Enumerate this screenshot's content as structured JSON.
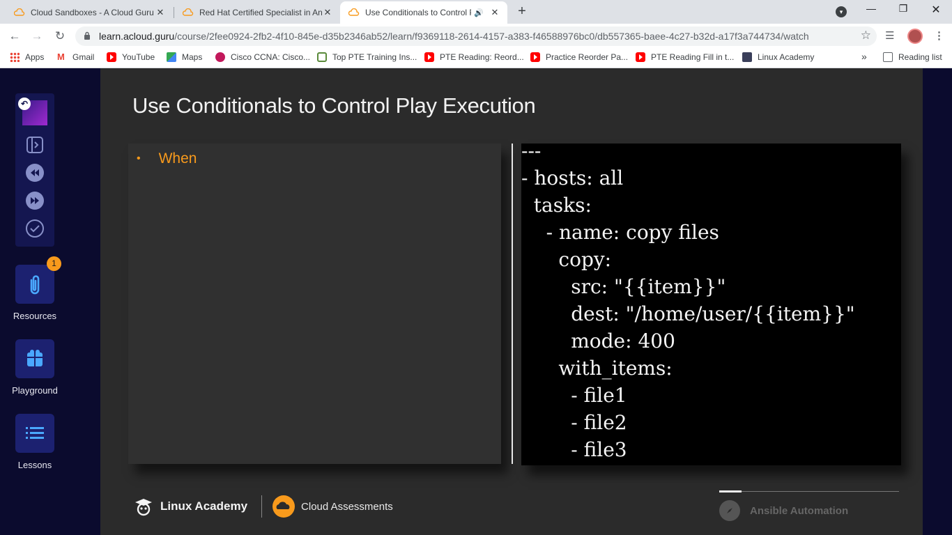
{
  "browser": {
    "tabs": [
      {
        "title": "Cloud Sandboxes - A Cloud Guru",
        "close": "✕"
      },
      {
        "title": "Red Hat Certified Specialist in An",
        "close": "✕"
      },
      {
        "title": "Use Conditionals to Control P",
        "close": "✕",
        "active": true
      }
    ],
    "new_tab": "+",
    "url_host": "learn.acloud.guru",
    "url_path": "/course/2fee0924-2fb2-4f10-845e-d35b2346ab52/learn/f9369118-2614-4157-a383-f46588976bc0/db557365-baee-4c27-b32d-a17f3a744734/watch",
    "bookmarks": [
      {
        "label": "Apps",
        "icon": "apps-icon"
      },
      {
        "label": "Gmail",
        "icon": "gmail-icon"
      },
      {
        "label": "YouTube",
        "icon": "youtube-icon"
      },
      {
        "label": "Maps",
        "icon": "maps-icon"
      },
      {
        "label": "Cisco CCNA: Cisco...",
        "icon": "cisco-icon"
      },
      {
        "label": "Top PTE Training Ins...",
        "icon": "pte-icon"
      },
      {
        "label": "PTE Reading: Reord...",
        "icon": "youtube-icon"
      },
      {
        "label": "Practice Reorder Pa...",
        "icon": "youtube-icon"
      },
      {
        "label": "PTE Reading Fill in t...",
        "icon": "youtube-icon"
      },
      {
        "label": "Linux Academy",
        "icon": "linux-academy-icon"
      }
    ],
    "more": "»",
    "reading_list": "Reading list"
  },
  "sidebar": {
    "resources_label": "Resources",
    "resources_badge": "1",
    "playground_label": "Playground",
    "lessons_label": "Lessons"
  },
  "slide": {
    "title": "Use Conditionals to Control Play Execution",
    "bullet": "When",
    "code_lines": [
      "---",
      "- hosts: all",
      "  tasks:",
      "    - name: copy files",
      "      copy:",
      "        src: \"{{item}}\"",
      "        dest: \"/home/user/{{item}}\"",
      "        mode: 400",
      "      with_items:",
      "        - file1",
      "        - file2",
      "        - file3"
    ],
    "footer_brand": "Linux Academy",
    "footer_assess": "Cloud Assessments",
    "footer_course": "Ansible Automation"
  },
  "colors": {
    "accent_orange": "#f89a1c",
    "slide_bg": "#2b2b2b",
    "rail_bg": "#0b0b2e"
  }
}
